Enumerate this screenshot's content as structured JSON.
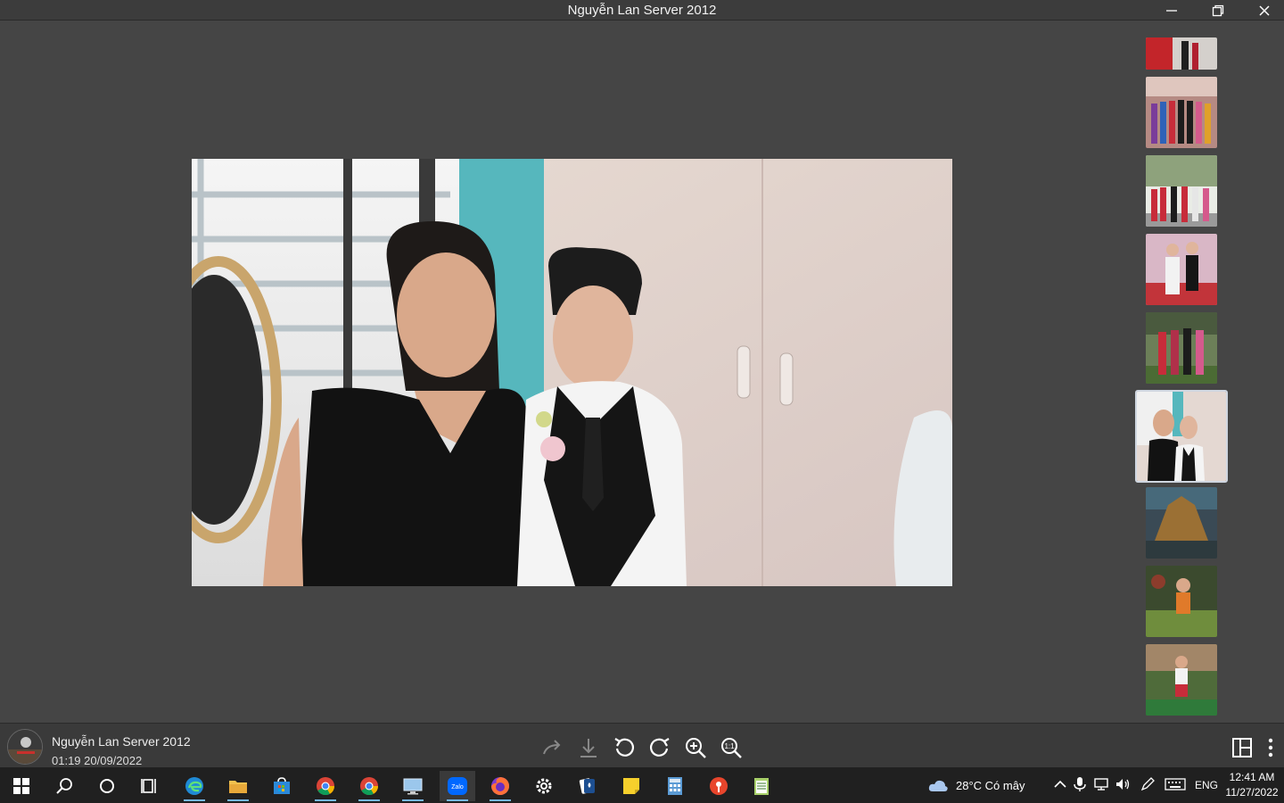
{
  "window": {
    "title": "Nguyễn Lan Server 2012",
    "controls": {
      "minimize": "minimize-icon",
      "restore": "restore-icon",
      "close": "close-icon"
    }
  },
  "photo": {
    "description_icon": "photo-couple",
    "thumbnails": [
      {
        "icon": "group-photo-thumbnail"
      },
      {
        "icon": "group-photo-thumbnail"
      },
      {
        "icon": "group-photo-thumbnail"
      },
      {
        "icon": "couple-photo-thumbnail"
      },
      {
        "icon": "group-photo-thumbnail"
      },
      {
        "icon": "selected-photo-thumbnail",
        "active": true
      },
      {
        "icon": "decoration-photo-thumbnail"
      },
      {
        "icon": "child-photo-thumbnail"
      },
      {
        "icon": "child-photo-thumbnail"
      }
    ]
  },
  "bottombar": {
    "sender": "Nguyễn Lan Server 2012",
    "datetime": "01:19 20/09/2022",
    "tools": [
      "share-icon",
      "download-icon",
      "rotate-left-icon",
      "rotate-right-icon",
      "zoom-in-icon",
      "actual-size-icon"
    ],
    "right_tools": [
      "layout-icon",
      "more-icon"
    ]
  },
  "taskbar": {
    "apps": [
      "windows-start-icon",
      "search-icon",
      "cortana-icon",
      "task-view-icon",
      "edge-icon",
      "file-explorer-icon",
      "store-icon",
      "chrome-icon",
      "chrome-alt-icon",
      "remote-desktop-icon",
      "zalo-icon",
      "firefox-icon",
      "settings-icon",
      "solitaire-icon",
      "sticky-notes-icon",
      "calculator-icon",
      "maps-icon",
      "notepad-icon"
    ],
    "zalo_label": "Zalo",
    "weather": "28°C  Có mây",
    "language": "ENG",
    "time": "12:41 AM",
    "date": "11/27/2022"
  },
  "colors": {
    "background": "#454545",
    "taskbar": "#202020",
    "accent": "#76b9ed"
  }
}
